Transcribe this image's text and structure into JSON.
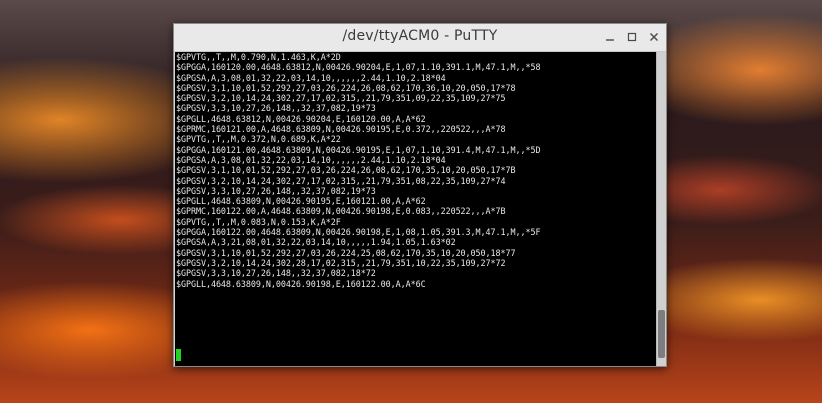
{
  "window": {
    "title": "/dev/ttyACM0 - PuTTY",
    "buttons": {
      "minimize": "–",
      "maximize": "▫",
      "close": "✕"
    }
  },
  "terminal": {
    "lines": [
      "$GPVTG,,T,,M,0.790,N,1.463,K,A*2D",
      "$GPGGA,160120.00,4648.63812,N,00426.90204,E,1,07,1.10,391.1,M,47.1,M,,*58",
      "$GPGSA,A,3,08,01,32,22,03,14,10,,,,,,2.44,1.10,2.18*04",
      "$GPGSV,3,1,10,01,52,292,27,03,26,224,26,08,62,170,36,10,20,050,17*78",
      "$GPGSV,3,2,10,14,24,302,27,17,02,315,,21,79,351,09,22,35,109,27*75",
      "$GPGSV,3,3,10,27,26,148,,32,37,082,19*73",
      "$GPGLL,4648.63812,N,00426.90204,E,160120.00,A,A*62",
      "$GPRMC,160121.00,A,4648.63809,N,00426.90195,E,0.372,,220522,,,A*78",
      "$GPVTG,,T,,M,0.372,N,0.689,K,A*22",
      "$GPGGA,160121.00,4648.63809,N,00426.90195,E,1,07,1.10,391.4,M,47.1,M,,*5D",
      "$GPGSA,A,3,08,01,32,22,03,14,10,,,,,,2.44,1.10,2.18*04",
      "$GPGSV,3,1,10,01,52,292,27,03,26,224,26,08,62,170,35,10,20,050,17*7B",
      "$GPGSV,3,2,10,14,24,302,27,17,02,315,,21,79,351,08,22,35,109,27*74",
      "$GPGSV,3,3,10,27,26,148,,32,37,082,19*73",
      "$GPGLL,4648.63809,N,00426.90195,E,160121.00,A,A*62",
      "$GPRMC,160122.00,A,4648.63809,N,00426.90198,E,0.083,,220522,,,A*7B",
      "$GPVTG,,T,,M,0.083,N,0.153,K,A*2F",
      "$GPGGA,160122.00,4648.63809,N,00426.90198,E,1,08,1.05,391.3,M,47.1,M,,*5F",
      "$GPGSA,A,3,21,08,01,32,22,03,14,10,,,,,1.94,1.05,1.63*02",
      "$GPGSV,3,1,10,01,52,292,27,03,26,224,25,08,62,170,35,10,20,050,18*77",
      "$GPGSV,3,2,10,14,24,302,28,17,02,315,,21,79,351,10,22,35,109,27*72",
      "$GPGSV,3,3,10,27,26,148,,32,37,082,18*72",
      "$GPGLL,4648.63809,N,00426.90198,E,160122.00,A,A*6C"
    ],
    "cursor_color": "#21d421"
  },
  "scrollbar": {
    "position_fraction": 0.9
  }
}
